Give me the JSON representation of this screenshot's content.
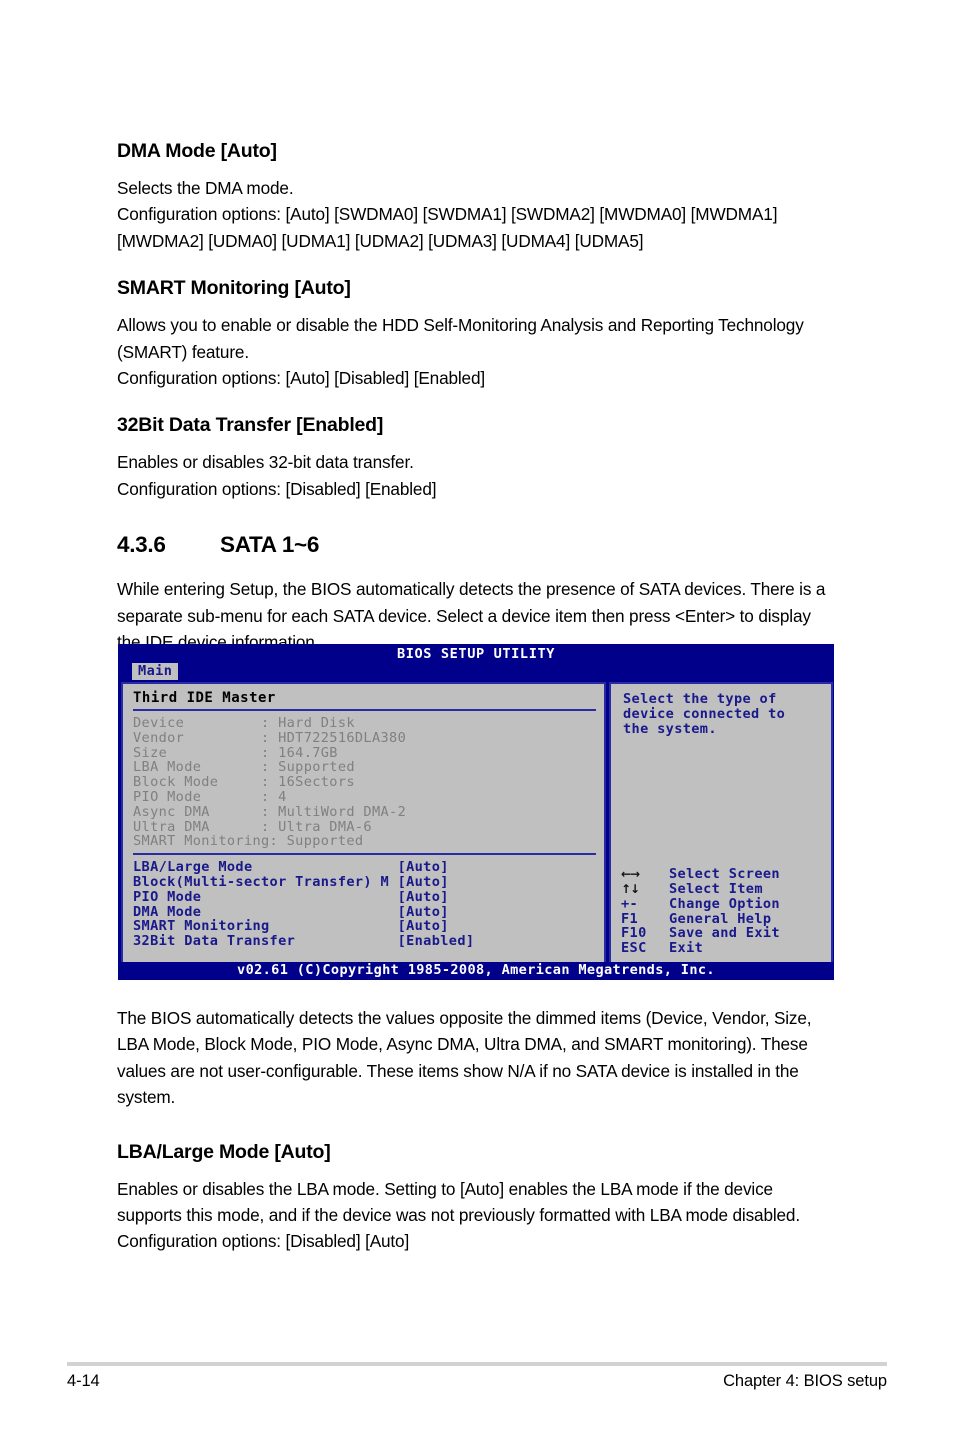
{
  "document": {
    "sections": [
      {
        "heading": "DMA Mode [Auto]",
        "paragraphs": [
          "Selects the DMA mode.\nConfiguration options: [Auto] [SWDMA0] [SWDMA1] [SWDMA2] [MWDMA0] [MWDMA1] [MWDMA2] [UDMA0] [UDMA1] [UDMA2] [UDMA3] [UDMA4] [UDMA5]"
        ]
      },
      {
        "heading": "SMART Monitoring [Auto]",
        "paragraphs": [
          "Allows you to enable or disable the HDD Self-Monitoring Analysis and Reporting Technology (SMART) feature.\nConfiguration options: [Auto] [Disabled] [Enabled]"
        ]
      },
      {
        "heading": "32Bit Data Transfer [Enabled]",
        "paragraphs": [
          "Enables or disables 32-bit data transfer.\nConfiguration options: [Disabled] [Enabled]"
        ]
      }
    ],
    "section_number": "4.3.6",
    "section_title": "SATA 1~6",
    "intro_paragraph": "While entering Setup, the BIOS automatically detects the presence of SATA devices. There is a separate sub-menu for each SATA device. Select a device item then press <Enter> to display the IDE device information.",
    "after_figure_paragraph": "The BIOS automatically detects the values opposite the dimmed items (Device, Vendor, Size, LBA Mode, Block Mode, PIO Mode, Async DMA, Ultra DMA, and SMART monitoring). These values are not user-configurable. These items show N/A if no SATA device is installed in the system.",
    "last_section": {
      "heading": "LBA/Large Mode [Auto]",
      "paragraph": "Enables or disables the LBA mode. Setting to [Auto] enables the LBA mode if the device supports this mode, and if the device was not previously formatted with LBA mode disabled.\nConfiguration options: [Disabled] [Auto]"
    }
  },
  "bios": {
    "title": "BIOS SETUP UTILITY",
    "active_tab": "Main",
    "panel_heading": "Third IDE Master",
    "info_rows": [
      {
        "label": "Device         ",
        "sep": ": ",
        "value": "Hard Disk"
      },
      {
        "label": "Vendor         ",
        "sep": ": ",
        "value": "HDT722516DLA380"
      },
      {
        "label": "Size           ",
        "sep": ": ",
        "value": "164.7GB"
      },
      {
        "label": "LBA Mode       ",
        "sep": ": ",
        "value": "Supported"
      },
      {
        "label": "Block Mode     ",
        "sep": ": ",
        "value": "16Sectors"
      },
      {
        "label": "PIO Mode       ",
        "sep": ": ",
        "value": "4"
      },
      {
        "label": "Async DMA      ",
        "sep": ": ",
        "value": "MultiWord DMA-2"
      },
      {
        "label": "Ultra DMA      ",
        "sep": ": ",
        "value": "Ultra DMA-6"
      },
      {
        "label": "SMART Monitoring",
        "sep": ": ",
        "value": "Supported"
      }
    ],
    "config_rows": [
      {
        "label": "LBA/Large Mode",
        "value": "[Auto]"
      },
      {
        "label": "Block(Multi-sector Transfer) M",
        "value": "[Auto]"
      },
      {
        "label": "PIO Mode",
        "value": "[Auto]"
      },
      {
        "label": "DMA Mode",
        "value": "[Auto]"
      },
      {
        "label": "SMART Monitoring",
        "value": "[Auto]"
      },
      {
        "label": "32Bit Data Transfer",
        "value": "[Enabled]"
      }
    ],
    "help_text": "Select the type of\ndevice connected to\nthe system.",
    "keys": [
      {
        "key": "←→",
        "desc": "Select Screen",
        "glyph": true
      },
      {
        "key": "↑↓",
        "desc": "Select Item",
        "glyph": true
      },
      {
        "key": "+-",
        "desc": "Change Option",
        "glyph": false
      },
      {
        "key": "F1",
        "desc": "General Help",
        "glyph": false
      },
      {
        "key": "F10",
        "desc": "Save and Exit",
        "glyph": false
      },
      {
        "key": "ESC",
        "desc": "Exit",
        "glyph": false
      }
    ],
    "footer": "v02.61 (C)Copyright 1985-2008, American Megatrends, Inc.",
    "colors": {
      "window_blue": "#00008B",
      "panel_gray": "#C0C0C0",
      "text_blue": "#19198C",
      "dimmed_gray": "#808080",
      "border_blue": "#2A2AA5"
    }
  },
  "page_footer": {
    "page_number": "4-14",
    "chapter": "Chapter 4: BIOS setup"
  }
}
